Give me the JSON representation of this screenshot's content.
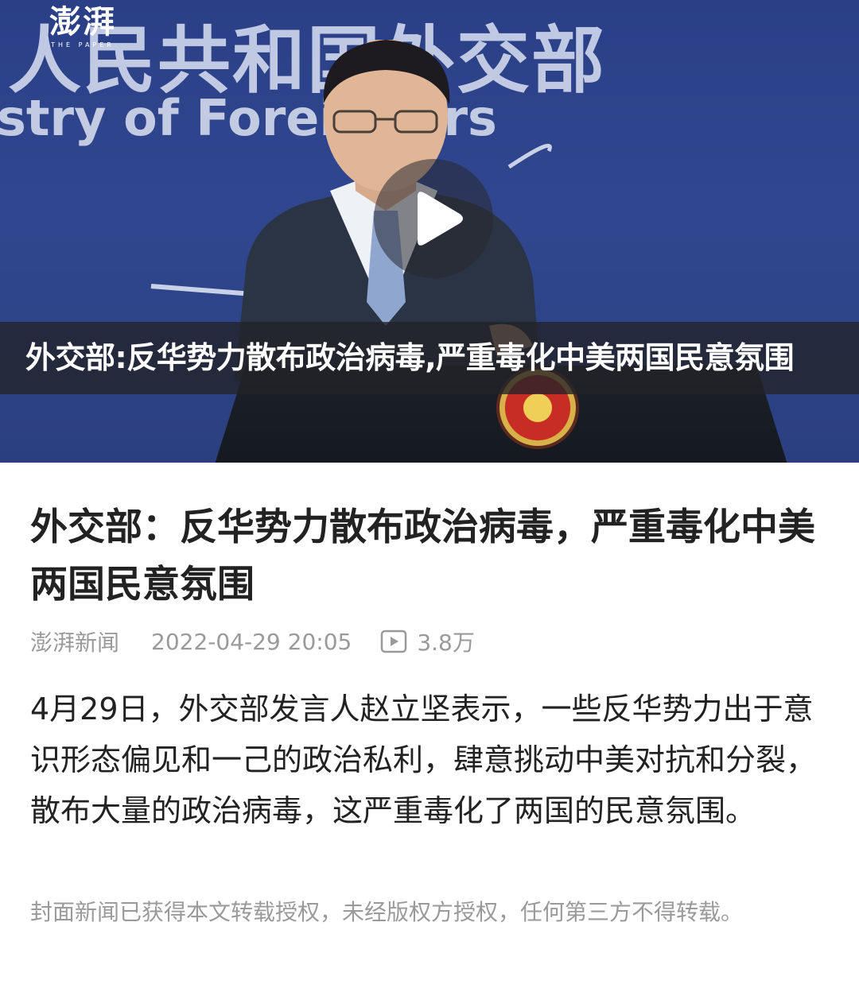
{
  "video": {
    "background_cn_text": "人民共和国外交部",
    "background_en_text": "stry of Forei  ffairs",
    "watermark": "澎湃",
    "watermark_sub": "THE PAPER",
    "caption": "外交部:反华势力散布政治病毒,严重毒化中美两国民意氛围",
    "colors": {
      "backdrop": "#2d4388",
      "caption_bg": "rgba(35,35,40,0.78)"
    }
  },
  "article": {
    "title": "外交部：反华势力散布政治病毒，严重毒化中美两国民意氛围",
    "source": "澎湃新闻",
    "datetime": "2022-04-29 20:05",
    "views_icon": "play-square-icon",
    "views": "3.8万",
    "body": "4月29日，外交部发言人赵立坚表示，一些反华势力出于意识形态偏见和一己的政治私利，肆意挑动中美对抗和分裂，散布大量的政治病毒，这严重毒化了两国的民意氛围。",
    "notice": "封面新闻已获得本文转载授权，未经版权方授权，任何第三方不得转载。"
  },
  "colors": {
    "title_text": "#222222",
    "meta_text": "#9a9a9a",
    "notice_text": "#9a9a9a"
  }
}
